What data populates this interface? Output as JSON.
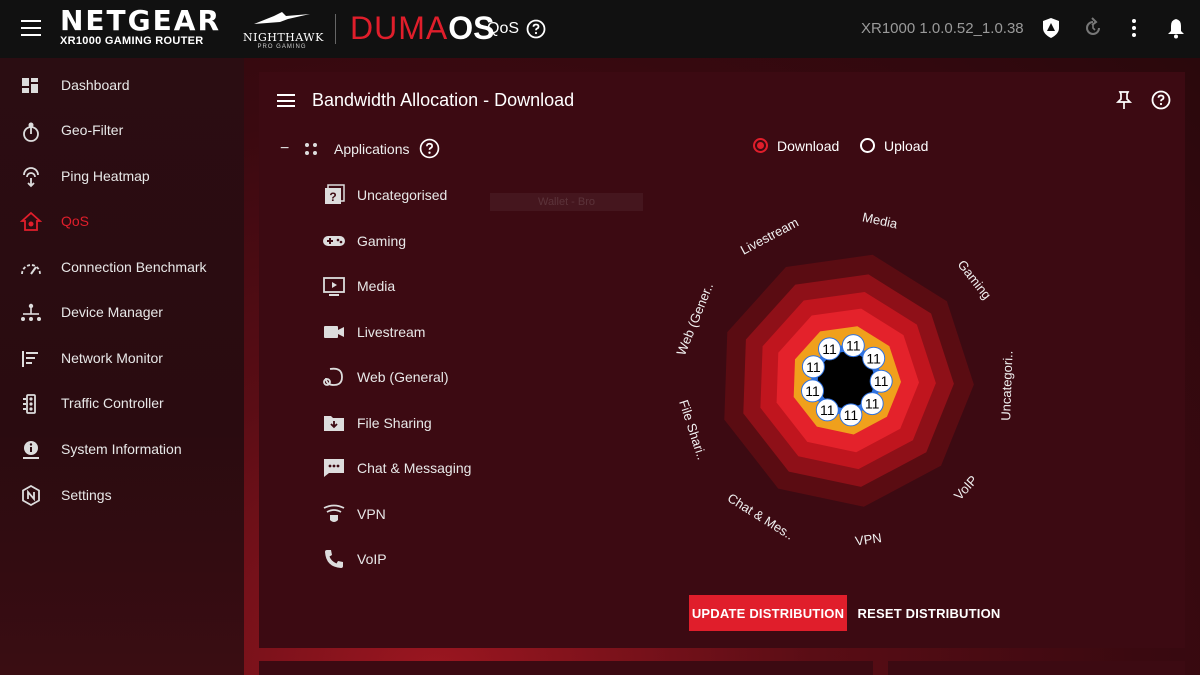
{
  "topbar": {
    "brand": "NETGEAR",
    "model_sub": "XR1000 GAMING ROUTER",
    "nighthawk": "NIGHTHAWK",
    "nighthawk_sub": "PRO GAMING",
    "duma_1": "DUMA",
    "duma_2": "OS",
    "page_label": "QoS",
    "version": "XR1000 1.0.0.52_1.0.38",
    "icons": [
      "menu-icon",
      "help-icon",
      "shield-icon",
      "refresh-icon",
      "more-vert-icon",
      "bell-icon"
    ]
  },
  "sidebar": {
    "items": [
      {
        "label": "Dashboard",
        "icon": "dashboard-icon"
      },
      {
        "label": "Geo-Filter",
        "icon": "geo-filter-icon"
      },
      {
        "label": "Ping Heatmap",
        "icon": "ping-heatmap-icon"
      },
      {
        "label": "QoS",
        "icon": "qos-icon",
        "active": true
      },
      {
        "label": "Connection Benchmark",
        "icon": "speedometer-icon"
      },
      {
        "label": "Device Manager",
        "icon": "device-tree-icon"
      },
      {
        "label": "Network Monitor",
        "icon": "network-monitor-icon"
      },
      {
        "label": "Traffic Controller",
        "icon": "traffic-controller-icon"
      },
      {
        "label": "System Information",
        "icon": "info-icon"
      },
      {
        "label": "Settings",
        "icon": "settings-icon"
      }
    ]
  },
  "panel": {
    "title": "Bandwidth Allocation - Download",
    "collapse": "−",
    "apps_label": "Applications",
    "categories": [
      {
        "label": "Uncategorised",
        "icon": "uncategorised-icon"
      },
      {
        "label": "Gaming",
        "icon": "gamepad-icon"
      },
      {
        "label": "Media",
        "icon": "media-icon"
      },
      {
        "label": "Livestream",
        "icon": "livestream-icon"
      },
      {
        "label": "Web (General)",
        "icon": "web-icon"
      },
      {
        "label": "File Sharing",
        "icon": "file-sharing-icon"
      },
      {
        "label": "Chat & Messaging",
        "icon": "chat-icon"
      },
      {
        "label": "VPN",
        "icon": "vpn-icon"
      },
      {
        "label": "VoIP",
        "icon": "phone-icon"
      }
    ],
    "ghost_tooltip": "Wallet - Bro",
    "radio_download": "Download",
    "radio_upload": "Upload",
    "selected_direction": "Download",
    "update_button": "UPDATE DISTRIBUTION",
    "reset_button": "RESET DISTRIBUTION"
  },
  "chart_data": {
    "type": "radar",
    "categories": [
      "Media",
      "Gaming",
      "Uncategori..",
      "VoIP",
      "VPN",
      "Chat & Mes..",
      "File Shari..",
      "Web (Gener..",
      "Livestream"
    ],
    "values": [
      11,
      11,
      11,
      11,
      11,
      11,
      11,
      11,
      11
    ],
    "ring_colors": [
      "#5a0c12",
      "#8e1018",
      "#c0151e",
      "#e4222b",
      "#f0a01c",
      "#2f72e0",
      "#000000"
    ],
    "marker_color": "#ffffff"
  },
  "colors": {
    "accent": "#e01e2b",
    "topbar": "#111111",
    "panel": "#3c0a12"
  }
}
